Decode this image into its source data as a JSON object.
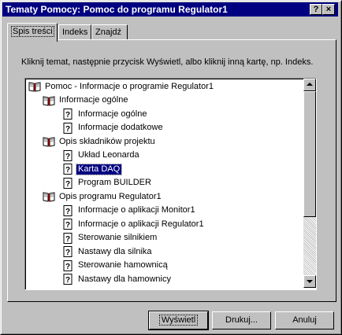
{
  "window": {
    "title": "Tematy Pomocy: Pomoc do programu Regulator1",
    "help_button": "?",
    "close_button": "×"
  },
  "tabs": [
    {
      "label": "Spis treści",
      "active": true
    },
    {
      "label": "Indeks",
      "active": false
    },
    {
      "label": "Znajdź",
      "active": false
    }
  ],
  "instruction": "Kliknij temat, następnie przycisk Wyświetl, albo kliknij inną kartę, np. Indeks.",
  "tree": [
    {
      "label": "Pomoc - Informacje o programie Regulator1",
      "icon": "book-open-icon",
      "level": 0
    },
    {
      "label": "Informacje ogólne",
      "icon": "book-open-icon",
      "level": 1
    },
    {
      "label": "Informacje ogólne",
      "icon": "help-page-icon",
      "level": 2
    },
    {
      "label": "Informacje dodatkowe",
      "icon": "help-page-icon",
      "level": 2
    },
    {
      "label": "Opis składników projektu",
      "icon": "book-open-icon",
      "level": 1
    },
    {
      "label": "Układ Leonarda",
      "icon": "help-page-icon",
      "level": 2
    },
    {
      "label": "Karta DAQ",
      "icon": "help-page-icon",
      "level": 2,
      "selected": true
    },
    {
      "label": "Program BUILDER",
      "icon": "help-page-icon",
      "level": 2
    },
    {
      "label": "Opis programu Regulator1",
      "icon": "book-open-icon",
      "level": 1
    },
    {
      "label": "Informacje o aplikacji Monitor1",
      "icon": "help-page-icon",
      "level": 2
    },
    {
      "label": "Informacje o aplikacji Regulator1",
      "icon": "help-page-icon",
      "level": 2
    },
    {
      "label": "Sterowanie silnikiem",
      "icon": "help-page-icon",
      "level": 2
    },
    {
      "label": "Nastawy dla silnika",
      "icon": "help-page-icon",
      "level": 2
    },
    {
      "label": "Sterowanie hamownicą",
      "icon": "help-page-icon",
      "level": 2
    },
    {
      "label": "Nastawy dla hamownicy",
      "icon": "help-page-icon",
      "level": 2
    }
  ],
  "buttons": {
    "show": "Wyświetl",
    "print": "Drukuj...",
    "cancel": "Anuluj"
  }
}
